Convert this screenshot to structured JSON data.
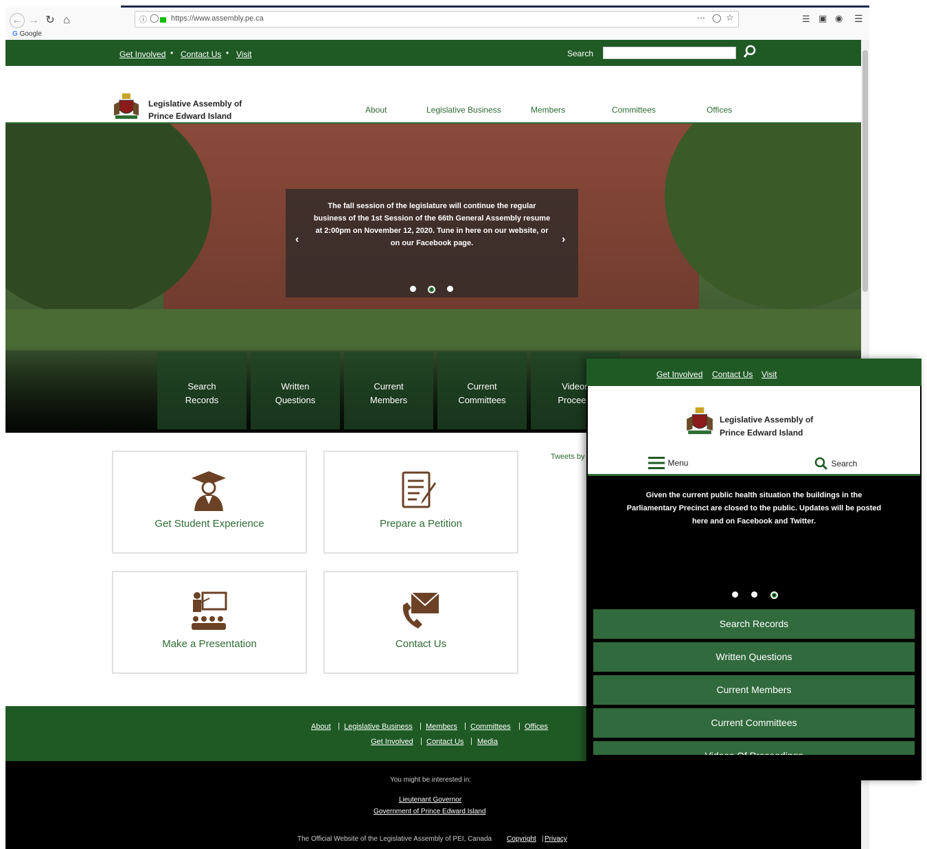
{
  "browser": {
    "url": "https://www.assembly.pe.ca",
    "bookmark": "Google"
  },
  "site": {
    "top_links": [
      "Get Involved",
      "Contact Us",
      "Visit"
    ],
    "search_label": "Search",
    "logo_line1": "Legislative Assembly of",
    "logo_line2": "Prince Edward Island",
    "nav": [
      "About",
      "Legislative Business",
      "Members",
      "Committees",
      "Offices"
    ],
    "carousel_caption": "The fall session of the legislature will continue the regular business of the 1st Session of the 66th General Assembly resume at 2:00pm on November 12, 2020. Tune in here on our website, or on our Facebook page.",
    "tiles": [
      {
        "line1": "Search",
        "line2": "Records"
      },
      {
        "line1": "Written",
        "line2": "Questions"
      },
      {
        "line1": "Current",
        "line2": "Members"
      },
      {
        "line1": "Current",
        "line2": "Committees"
      },
      {
        "line1": "Videos",
        "line2": "Proceedi"
      }
    ],
    "cards": [
      "Get Student Experience",
      "Prepare a Petition",
      "Make a Presentation",
      "Contact Us"
    ],
    "tweets_label": "Tweets by",
    "footer_row1": [
      "About",
      "Legislative Business",
      "Members",
      "Committees",
      "Offices"
    ],
    "footer_row2": [
      "Get Involved",
      "Contact Us",
      "Media"
    ],
    "interested_label": "You might be interested in:",
    "interested_links": [
      "Lieutenant Governor",
      "Government of Prince Edward Island"
    ],
    "official_text": "The Official Website of the Legislative Assembly of PEI, Canada",
    "copyright": "Copyright",
    "privacy": "Privacy"
  },
  "mobile": {
    "top_links": [
      "Get Involved",
      "Contact Us",
      "Visit"
    ],
    "logo_line1": "Legislative Assembly of",
    "logo_line2": "Prince Edward Island",
    "menu_label": "Menu",
    "search_label": "Search",
    "caption": "Given the current public health situation the buildings in the Parliamentary Precinct are closed to the public. Updates will be posted here and on Facebook and Twitter.",
    "tiles": [
      "Search Records",
      "Written Questions",
      "Current Members",
      "Current Committees",
      "Videos Of Proceedings"
    ]
  },
  "colors": {
    "brand_green": "#1f5a25",
    "card_text_green": "#2e6b34",
    "icon_brown": "#6b4226"
  }
}
